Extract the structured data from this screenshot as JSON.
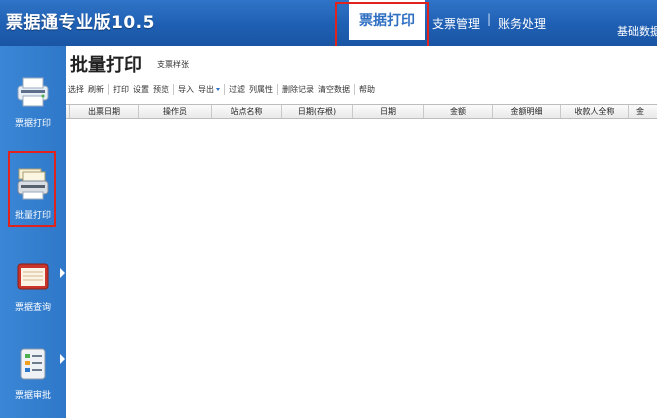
{
  "app": {
    "title": "票据通专业版10.5"
  },
  "top_nav": {
    "tabs": [
      {
        "label": "票据打印",
        "active": true
      },
      {
        "label": "支票管理",
        "active": false
      },
      {
        "label": "账务处理",
        "active": false
      }
    ],
    "separator": "|",
    "right_label": "基础数据"
  },
  "sidebar": {
    "items": [
      {
        "label": "票据打印",
        "icon": "printer-icon",
        "has_arrow": false
      },
      {
        "label": "批量打印",
        "icon": "batch-printer-icon",
        "has_arrow": false
      },
      {
        "label": "票据查询",
        "icon": "ledger-icon",
        "has_arrow": true
      },
      {
        "label": "票据审批",
        "icon": "checklist-icon",
        "has_arrow": true
      }
    ]
  },
  "page": {
    "title": "批量打印",
    "subtitle": "支票样张"
  },
  "toolbar": {
    "select": "选择",
    "refresh": "刷新",
    "print": "打印",
    "settings": "设置",
    "preview": "预览",
    "import": "导入",
    "export": "导出",
    "filter": "过滤",
    "columns": "列属性",
    "delete_records": "删除记录",
    "clear_data": "清空数据",
    "help": "帮助"
  },
  "table": {
    "columns": [
      "出票日期",
      "操作员",
      "站点名称",
      "日期(存根)",
      "日期",
      "金额",
      "金额明细",
      "收款人全称",
      "金"
    ]
  },
  "colors": {
    "top_bar": "#1f5fb3",
    "sidebar": "#3b86d6",
    "active_tab_text": "#2f6fc2",
    "highlight_red": "#e0231c"
  }
}
